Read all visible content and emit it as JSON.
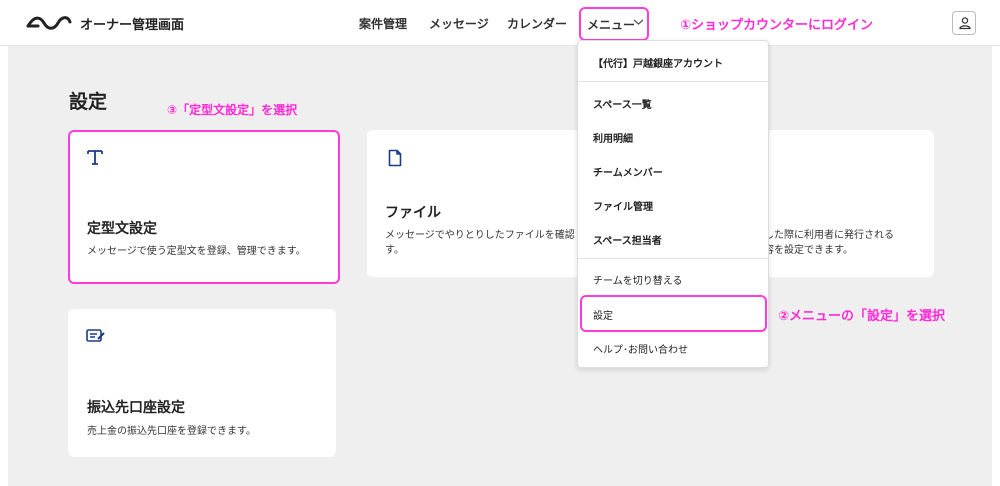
{
  "header": {
    "brand": "オーナー管理画面",
    "nav": [
      "案件管理",
      "メッセージ",
      "カレンダー"
    ],
    "menu_label": "メニュー"
  },
  "annotations": {
    "step1": "①ショップカウンターにログイン",
    "step2": "②メニューの「設定」を選択",
    "step3": "③「定型文設定」を選択",
    "color": "#ff2bd6"
  },
  "main": {
    "title": "設定",
    "cards": [
      {
        "title": "定型文設定",
        "desc": "メッセージで使う定型文を登録、管理できます。",
        "icon": "text-t-icon"
      },
      {
        "title": "ファイル",
        "desc_line1": "メッセージでやりとりしたファイルを確認",
        "desc_line2": "す。",
        "icon": "file-icon"
      },
      {
        "desc_line1": "した際に利用者に発行される",
        "desc_line2": "容を設定できます。"
      },
      {
        "title": "振込先口座設定",
        "desc": "売上金の振込先口座を登録できます。",
        "icon": "edit-note-icon"
      }
    ]
  },
  "dropdown": {
    "account": "【代行】戸越銀座アカウント",
    "items": [
      "スペース一覧",
      "利用明細",
      "チームメンバー",
      "ファイル管理",
      "スペース担当者"
    ],
    "switch_team": "チームを切り替える",
    "settings": "設定",
    "help": "ヘルプ･お問い合わせ"
  },
  "colors": {
    "highlight": "#ff3cdb",
    "background": "#efefef",
    "card": "#ffffff"
  }
}
